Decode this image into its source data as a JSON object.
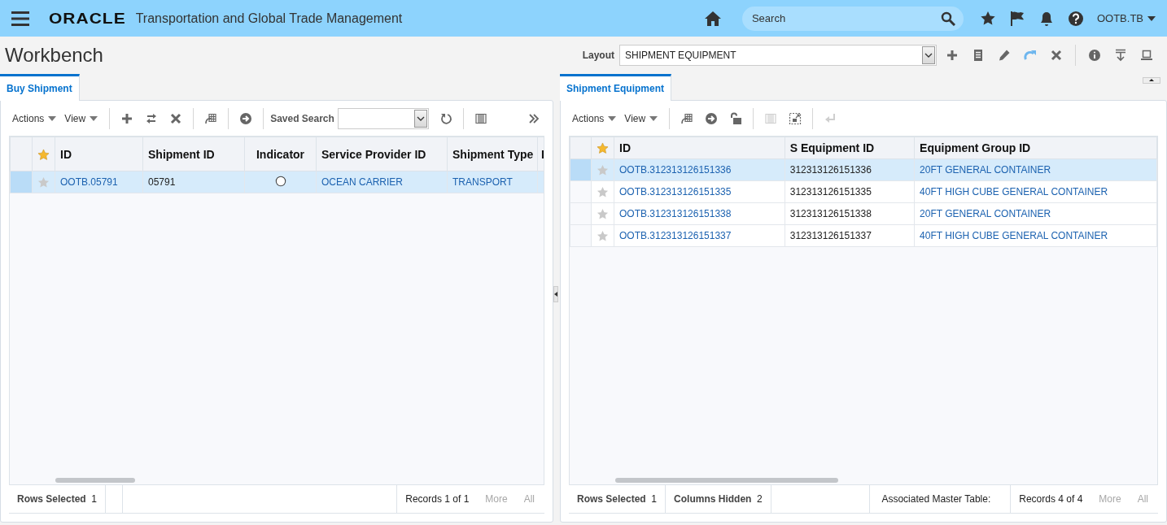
{
  "header": {
    "logo": "ORACLE",
    "app_title": "Transportation and Global Trade Management",
    "search": {
      "placeholder": "Search"
    },
    "user": "OOTB.TB"
  },
  "page_title": "Workbench",
  "layout": {
    "label": "Layout",
    "value": "SHIPMENT EQUIPMENT",
    "tools": [
      {
        "kind": "plus",
        "disabled": false
      },
      {
        "kind": "doc",
        "disabled": false
      },
      {
        "kind": "pencil",
        "disabled": false
      },
      {
        "kind": "redo",
        "disabled": false
      },
      {
        "kind": "cross",
        "disabled": false
      },
      {
        "kind": "separator"
      },
      {
        "kind": "info",
        "disabled": false
      },
      {
        "kind": "download",
        "disabled": false
      },
      {
        "kind": "laptop",
        "disabled": false
      }
    ]
  },
  "panels": [
    {
      "tab": {
        "label": "Buy Shipment",
        "selected": true
      },
      "toolbar": [
        {
          "kind": "menu",
          "label": "Actions"
        },
        {
          "kind": "menu",
          "label": "View"
        },
        {
          "kind": "separator"
        },
        {
          "kind": "plus",
          "disabled": false
        },
        {
          "kind": "swap",
          "disabled": false
        },
        {
          "kind": "cross",
          "disabled": false
        },
        {
          "kind": "separator"
        },
        {
          "kind": "export",
          "disabled": false
        },
        {
          "kind": "separator"
        },
        {
          "kind": "arrow",
          "disabled": false
        },
        {
          "kind": "separator"
        },
        {
          "kind": "saved-search",
          "label": "Saved Search"
        },
        {
          "kind": "refresh",
          "disabled": false
        },
        {
          "kind": "separator"
        },
        {
          "kind": "columns",
          "disabled": false
        },
        {
          "kind": "spacer"
        },
        {
          "kind": "chevrons",
          "disabled": false
        }
      ],
      "table": {
        "header_star": true,
        "columns": [
          {
            "label": "ID",
            "kind": "link"
          },
          {
            "label": "Shipment ID",
            "kind": "text"
          },
          {
            "label": "Indicator",
            "kind": "radio"
          },
          {
            "label": "Service Provider ID",
            "kind": "link"
          },
          {
            "label": "Shipment Type",
            "kind": "link"
          },
          {
            "label": "I",
            "kind": "link"
          }
        ],
        "rows": [
          {
            "selected": true,
            "favorite": false,
            "cells": [
              "OOTB.05791",
              "05791",
              {
                "checked": false
              },
              "OCEAN CARRIER",
              "TRANSPORT"
            ]
          }
        ]
      },
      "footer": {
        "rows_selected": {
          "label": "Rows Selected",
          "value": "1"
        },
        "records": "Records 1 of 1",
        "more": {
          "label": "More",
          "disabled": true
        },
        "all": {
          "label": "All",
          "disabled": true
        }
      }
    },
    {
      "tab": {
        "label": "Shipment Equipment",
        "selected": true
      },
      "toolbar": [
        {
          "kind": "menu",
          "label": "Actions"
        },
        {
          "kind": "menu",
          "label": "View"
        },
        {
          "kind": "separator"
        },
        {
          "kind": "export",
          "disabled": false
        },
        {
          "kind": "arrow",
          "disabled": false
        },
        {
          "kind": "unlock",
          "disabled": false
        },
        {
          "kind": "separator"
        },
        {
          "kind": "columns",
          "disabled": true
        },
        {
          "kind": "expand",
          "disabled": false
        },
        {
          "kind": "separator"
        },
        {
          "kind": "enter",
          "disabled": true
        }
      ],
      "table": {
        "header_star": true,
        "columns": [
          {
            "label": "ID",
            "kind": "link"
          },
          {
            "label": "S Equipment ID",
            "kind": "text"
          },
          {
            "label": "Equipment Group ID",
            "kind": "link"
          }
        ],
        "rows": [
          {
            "selected": true,
            "favorite": false,
            "cells": [
              "OOTB.312313126151336",
              "312313126151336",
              "20FT GENERAL CONTAINER"
            ]
          },
          {
            "selected": false,
            "favorite": false,
            "cells": [
              "OOTB.312313126151335",
              "312313126151335",
              "40FT HIGH CUBE GENERAL CONTAINER"
            ]
          },
          {
            "selected": false,
            "favorite": false,
            "cells": [
              "OOTB.312313126151338",
              "312313126151338",
              "20FT GENERAL CONTAINER"
            ]
          },
          {
            "selected": false,
            "favorite": false,
            "cells": [
              "OOTB.312313126151337",
              "312313126151337",
              "40FT HIGH CUBE GENERAL CONTAINER"
            ]
          }
        ]
      },
      "footer": {
        "rows_selected": {
          "label": "Rows Selected",
          "value": "1"
        },
        "columns_hidden": {
          "label": "Columns Hidden",
          "value": "2"
        },
        "associated": "Associated Master Table:",
        "records": "Records 4 of 4",
        "more": {
          "label": "More",
          "disabled": true
        },
        "all": {
          "label": "All",
          "disabled": true
        }
      }
    }
  ]
}
